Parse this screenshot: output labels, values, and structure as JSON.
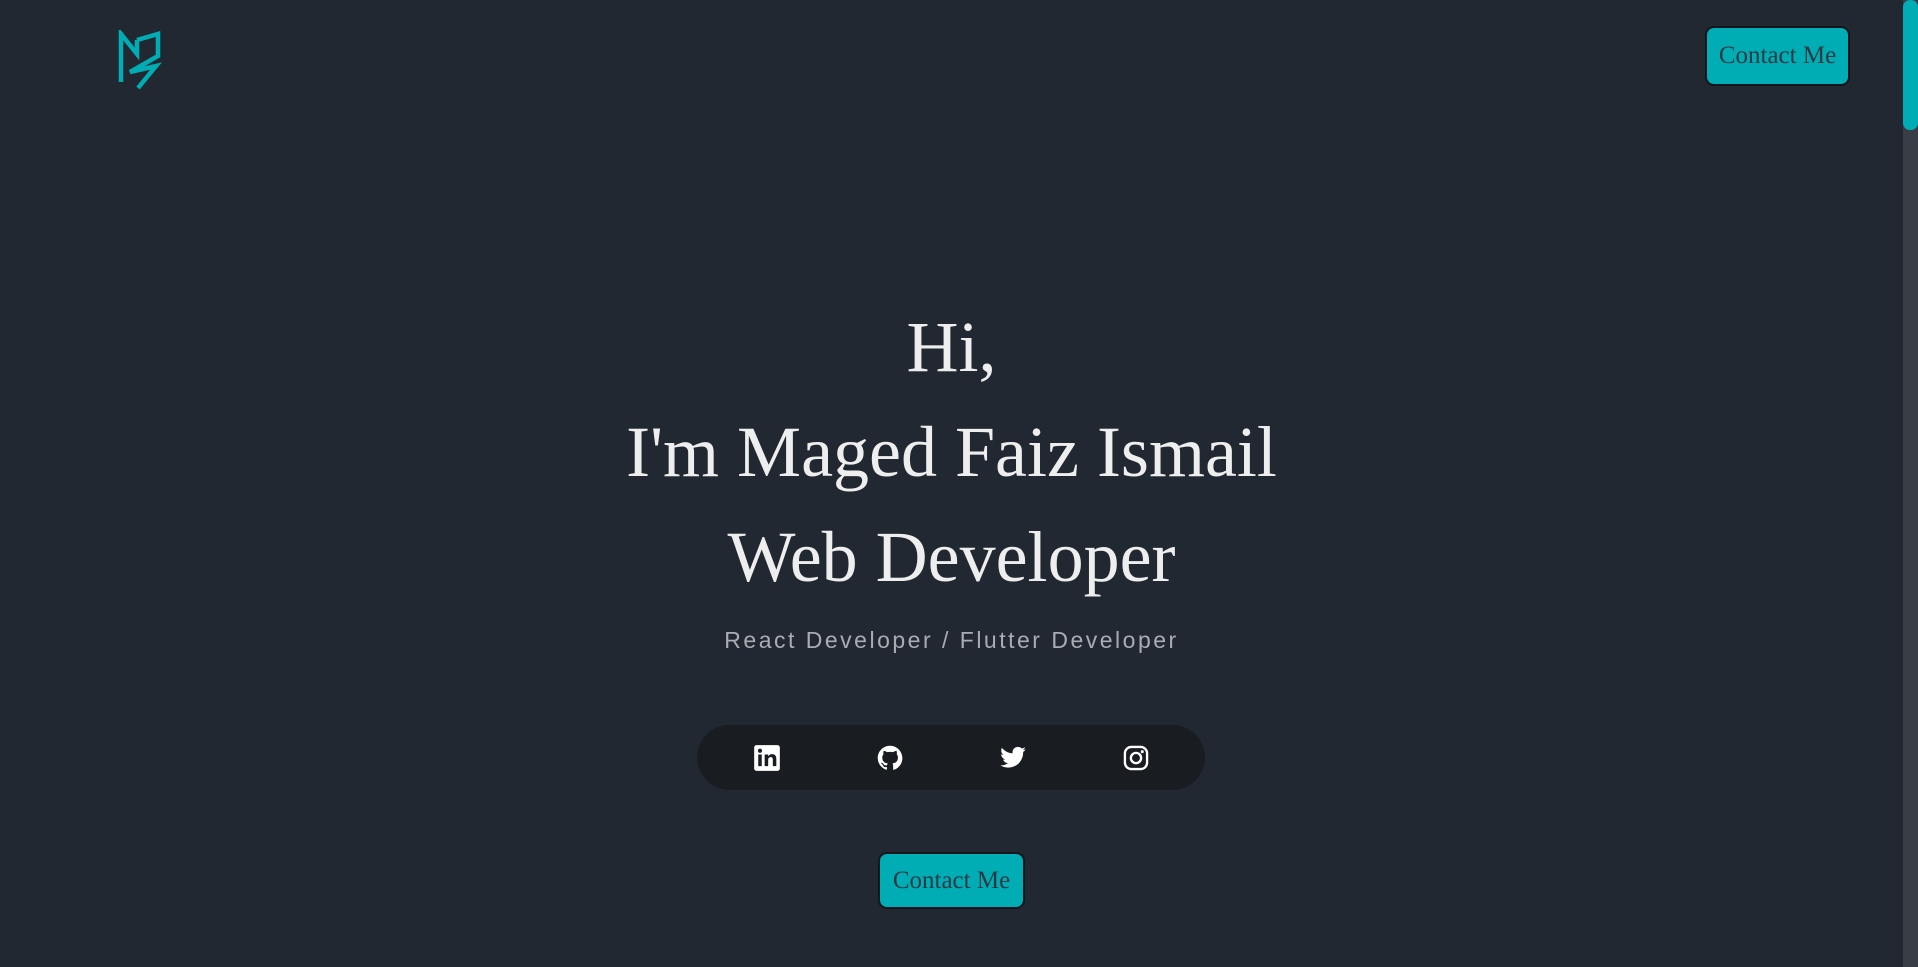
{
  "header": {
    "logo_icon": "mf-monogram-logo",
    "contact_button": "Contact Me"
  },
  "hero": {
    "greeting": "Hi,",
    "name_line": "I'm Maged Faiz Ismail",
    "role_line": "Web Developer",
    "tagline": "React Developer / Flutter Developer",
    "contact_button": "Contact Me"
  },
  "social": [
    {
      "icon": "linkedin-icon"
    },
    {
      "icon": "github-icon"
    },
    {
      "icon": "twitter-icon"
    },
    {
      "icon": "instagram-icon"
    }
  ],
  "colors": {
    "background": "#222831",
    "accent": "#00adb5",
    "text": "#eeeeee",
    "muted_text": "#a9adb2",
    "social_bar": "#191c21"
  }
}
